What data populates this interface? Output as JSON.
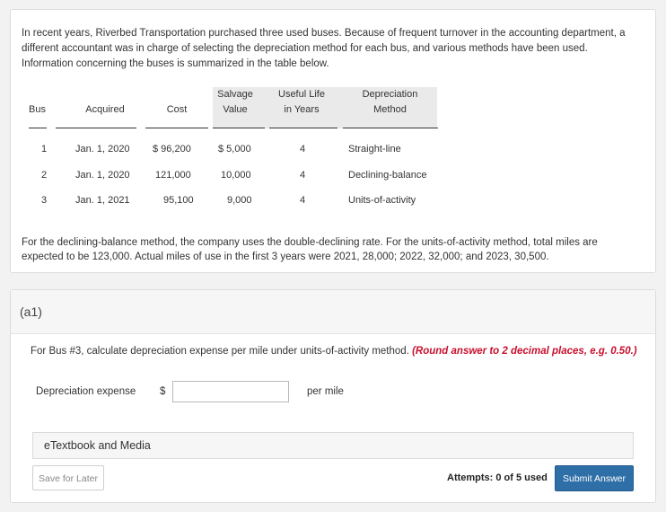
{
  "problem": {
    "intro": "In recent years, Riverbed Transportation purchased three used buses. Because of frequent turnover in the accounting department, a different accountant was in charge of selecting the depreciation method for each bus, and various methods have been used. Information concerning the buses is summarized in the table below.",
    "table": {
      "headers": {
        "bus": "Bus",
        "acquired": "Acquired",
        "cost": "Cost",
        "salvage_line1": "Salvage",
        "salvage_line2": "Value",
        "useful_line1": "Useful Life",
        "useful_line2": "in Years",
        "method_line1": "Depreciation",
        "method_line2": "Method"
      },
      "rows": [
        {
          "bus": "1",
          "acquired": "Jan. 1, 2020",
          "cost": "$ 96,200",
          "salvage": "$ 5,000",
          "useful": "4",
          "method": "Straight-line"
        },
        {
          "bus": "2",
          "acquired": "Jan. 1, 2020",
          "cost": "121,000",
          "salvage": "10,000",
          "useful": "4",
          "method": "Declining-balance"
        },
        {
          "bus": "3",
          "acquired": "Jan. 1, 2021",
          "cost": "95,100",
          "salvage": "9,000",
          "useful": "4",
          "method": "Units-of-activity"
        }
      ]
    },
    "note": "For the declining-balance method, the company uses the double-declining rate. For the units-of-activity method, total miles are expected to be 123,000. Actual miles of use in the first 3 years were 2021, 28,000; 2022, 32,000; and 2023, 30,500."
  },
  "part": {
    "label": "(a1)",
    "question": "For Bus #3, calculate depreciation expense per mile under units-of-activity method.",
    "rounding": "(Round answer to 2 decimal places, e.g. 0.50.)",
    "field_label": "Depreciation expense",
    "currency": "$",
    "value": "",
    "unit": "per mile",
    "etextbook": "eTextbook and Media",
    "save_label": "Save for Later",
    "attempts": "Attempts: 0 of 5 used",
    "submit_label": "Submit Answer"
  }
}
